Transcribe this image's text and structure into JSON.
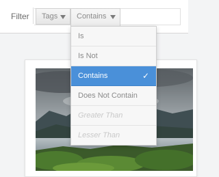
{
  "toolbar": {
    "filter_label": "Filter",
    "field_token": {
      "label": "Tags",
      "icon": "chevron-down-icon"
    },
    "operator_token": {
      "label": "Contains",
      "icon": "chevron-down-icon"
    }
  },
  "operator_menu": {
    "selected_index": 2,
    "items": [
      {
        "label": "Is",
        "state": "normal"
      },
      {
        "label": "Is Not",
        "state": "normal"
      },
      {
        "label": "Contains",
        "state": "selected",
        "icon": "check-icon"
      },
      {
        "label": "Does Not Contain",
        "state": "normal"
      },
      {
        "label": "Greater Than",
        "state": "disabled"
      },
      {
        "label": "Lesser Than",
        "state": "disabled"
      }
    ]
  },
  "colors": {
    "selected_bg": "#4a90d9",
    "toolbar_bg": "#ffffff",
    "page_bg": "#f3f4f5"
  }
}
